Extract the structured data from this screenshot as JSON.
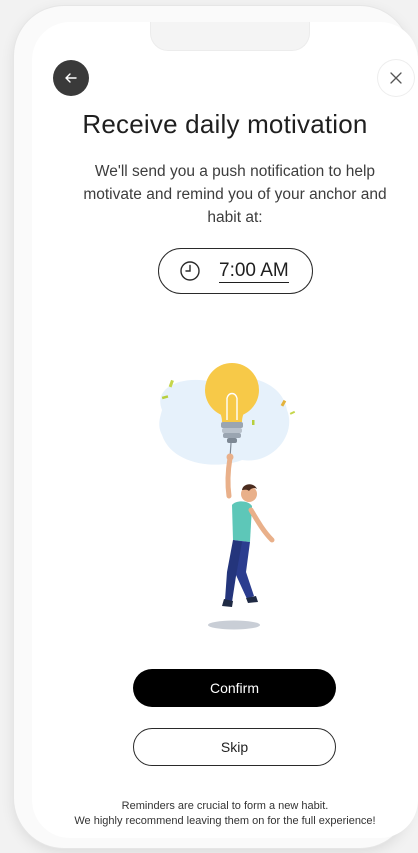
{
  "header": {
    "back_icon": "arrow-left-icon",
    "close_icon": "close-icon"
  },
  "title": "Receive daily motivation",
  "description": "We'll send you a push notification to help motivate and remind you of your anchor and habit at:",
  "reminder": {
    "icon": "clock-icon",
    "time": "7:00 AM"
  },
  "illustration": "lightbulb-balloon-person-illustration",
  "actions": {
    "confirm_label": "Confirm",
    "skip_label": "Skip"
  },
  "footer": {
    "line1": "Reminders are crucial to form a new habit.",
    "line2": "We highly recommend leaving them on for the full experience!"
  },
  "colors": {
    "primary_button": "#000000",
    "bulb": "#f7c948",
    "shirt": "#5dc7b8",
    "pants": "#2b3d8f",
    "blob": "#e6f1fb"
  }
}
